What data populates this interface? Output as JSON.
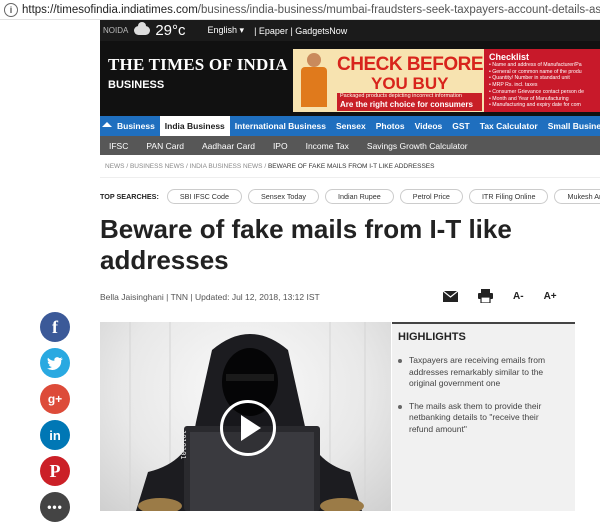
{
  "browser": {
    "url_host": "https://timesofindia.indiatimes.com",
    "url_path": "/business/india-business/mumbai-fraudsters-seek-taxpayers-account-details-as-jul"
  },
  "topbar": {
    "city": "NOIDA",
    "temperature": "29°c",
    "language": "English ▾",
    "links": "| Epaper | GadgetsNow"
  },
  "masthead": {
    "logo": "THE TIMES OF INDIA",
    "section": "BUSINESS"
  },
  "ad": {
    "headline_1": "CHECK BEFORE",
    "headline_2": "YOU BUY",
    "strip_small": "Packaged products depicting incorrect information",
    "strip_big": "Are the right choice for consumers",
    "checklist_title": "Checklist",
    "checklist": [
      "• Name and address of Manufacturer/Pa",
      "• General or common name of the produ",
      "• Quantity/ Number in standard unit",
      "• MRP Rs. incl. taxes",
      "• Consumer Grievance contact person de",
      "• Month and Year of Manufacturing",
      "• Manufacturing and expiry date for com"
    ]
  },
  "nav_primary": [
    "Business",
    "India Business",
    "International Business",
    "Sensex",
    "Photos",
    "Videos",
    "GST",
    "Tax Calculator",
    "Small Busine"
  ],
  "nav_secondary": [
    "IFSC",
    "PAN Card",
    "Aadhaar Card",
    "IPO",
    "Income Tax",
    "Savings Growth Calculator"
  ],
  "breadcrumb": {
    "items": [
      "NEWS",
      "BUSINESS NEWS",
      "INDIA BUSINESS NEWS"
    ],
    "separator": "/",
    "current": "BEWARE OF FAKE MAILS FROM I-T LIKE ADDRESSES"
  },
  "top_searches": {
    "label": "TOP SEARCHES:",
    "items": [
      "SBI IFSC Code",
      "Sensex Today",
      "Indian Rupee",
      "Petrol Price",
      "ITR Filing Online",
      "Mukesh Am"
    ]
  },
  "article": {
    "headline": "Beware of fake mails from I-T like addresses",
    "byline": "Bella Jaisinghani | TNN | Updated: Jul 12, 2018, 13:12 IST",
    "font_smaller": "A-",
    "font_larger": "A+",
    "image_binary": "1010101"
  },
  "highlights": {
    "title": "HIGHLIGHTS",
    "items": [
      "Taxpayers are receiving emails from addresses remarkably similar to the original government one",
      "The mails ask them to provide their netbanking details to \"receive their refund amount\""
    ]
  },
  "social": {
    "google_plus": "g+",
    "linkedin": "in"
  },
  "colors": {
    "nav_blue": "#1f6fbf",
    "nav_gray": "#575757",
    "ad_red": "#d8241c",
    "facebook": "#3b5998",
    "twitter": "#29a9e1",
    "pinterest": "#cb2027"
  }
}
